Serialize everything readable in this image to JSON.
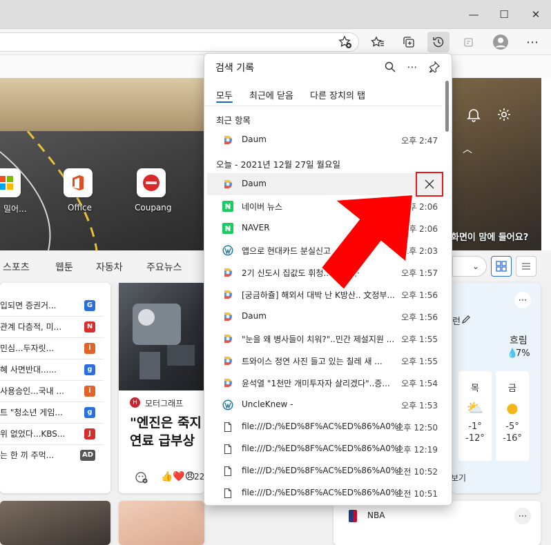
{
  "window": {
    "minimize": "—",
    "maximize": "☐",
    "close": "✕"
  },
  "hero": {
    "tiles": [
      {
        "label": "밀어...",
        "icon": "windows-icon"
      },
      {
        "label": "Office",
        "icon": "office-icon"
      },
      {
        "label": "Coupang",
        "icon": "coupang-icon"
      }
    ],
    "caption": "화면이 맘에 들어요?"
  },
  "nav": {
    "items": [
      "스포츠",
      "웹툰",
      "자동차",
      "주요뉴스"
    ]
  },
  "news": {
    "rows": [
      {
        "text": "입되면 증권거...",
        "badge": "G",
        "color": "#2a6fdb"
      },
      {
        "text": "관계 다층적, 미...",
        "badge": "N",
        "color": "#d62d2d"
      },
      {
        "text": "민심...두자릿...",
        "badge": "i",
        "color": "#e2632a"
      },
      {
        "text": "혜 사면반대......",
        "badge": "g",
        "color": "#2a6fdb"
      },
      {
        "text": "사용승인...국내 ...",
        "badge": "i",
        "color": "#e2632a"
      },
      {
        "text": "트 \"청소년 게임...",
        "badge": "g",
        "color": "#2a6fdb"
      },
      {
        "text": "위 없었다...KBS...",
        "badge": "J",
        "color": "#d62d2d"
      },
      {
        "text": "는 한 끼 주먹...",
        "badge": "AD",
        "color": "#555555"
      }
    ]
  },
  "article": {
    "source": "모터그래프",
    "headline1": "\"엔진은 죽지",
    "headline2": "연료 급부상",
    "reactions": "22"
  },
  "weather": {
    "status": "흐림",
    "humidity": "7%",
    "days": [
      {
        "day": "목",
        "temp": "-1°",
        "low": "-12°"
      },
      {
        "day": "금",
        "temp": "-5°",
        "low": "-16°"
      }
    ],
    "more": "보기",
    "partial": "런"
  },
  "sports": {
    "label": "NBA"
  },
  "panel": {
    "title": "검색 기록",
    "tabs": [
      "모두",
      "최근에 닫음",
      "다른 장치의 탭"
    ],
    "recent_heading": "최근 항목",
    "today_heading": "오늘 - 2021년 12월 27일 월요일",
    "recent": [
      {
        "title": "Daum",
        "time": "오후 2:47",
        "icon": "daum"
      }
    ],
    "today": [
      {
        "title": "Daum",
        "time": "",
        "icon": "daum"
      },
      {
        "title": "네이버 뉴스",
        "time": "오후 2:06",
        "icon": "naver"
      },
      {
        "title": "NAVER",
        "time": "오후 2:06",
        "icon": "naver"
      },
      {
        "title": "앱으로 현대카드 분실신고",
        "time": "오후 2:03",
        "icon": "wp"
      },
      {
        "title": "2기 신도시 집값도 휘청...어 위례·",
        "time": "오후 1:57",
        "icon": "daum"
      },
      {
        "title": "[궁금하쥴] 해외서 대박 난 K방산.. 文정부...",
        "time": "오후 1:56",
        "icon": "daum"
      },
      {
        "title": "Daum",
        "time": "오후 1:56",
        "icon": "daum"
      },
      {
        "title": "\"눈을 왜 병사들이 치워?\"..민간 제설지원 ...",
        "time": "오후 1:55",
        "icon": "daum"
      },
      {
        "title": "트와이스 정연 사진 들고 있는 칠레 새 ...",
        "time": "오후 1:55",
        "icon": "daum"
      },
      {
        "title": "윤석열 \"1천만 개미투자자 살리겠다\"..증...",
        "time": "오후 1:54",
        "icon": "daum"
      },
      {
        "title": "UncleKnew -",
        "time": "오후 1:53",
        "icon": "wp"
      },
      {
        "title": "file:///D:/%ED%8F%AC%ED%86%A0%E...",
        "time": "오후 12:50",
        "icon": "file"
      },
      {
        "title": "file:///D:/%ED%8F%AC%ED%86%A0%E...",
        "time": "오후 12:19",
        "icon": "file"
      },
      {
        "title": "file:///D:/%ED%8F%AC%ED%86%A0%E...",
        "time": "오전 10:52",
        "icon": "file"
      },
      {
        "title": "file:///D:/%ED%8F%AC%ED%86%A0%E...",
        "time": "오전 10:51",
        "icon": "file"
      }
    ]
  }
}
